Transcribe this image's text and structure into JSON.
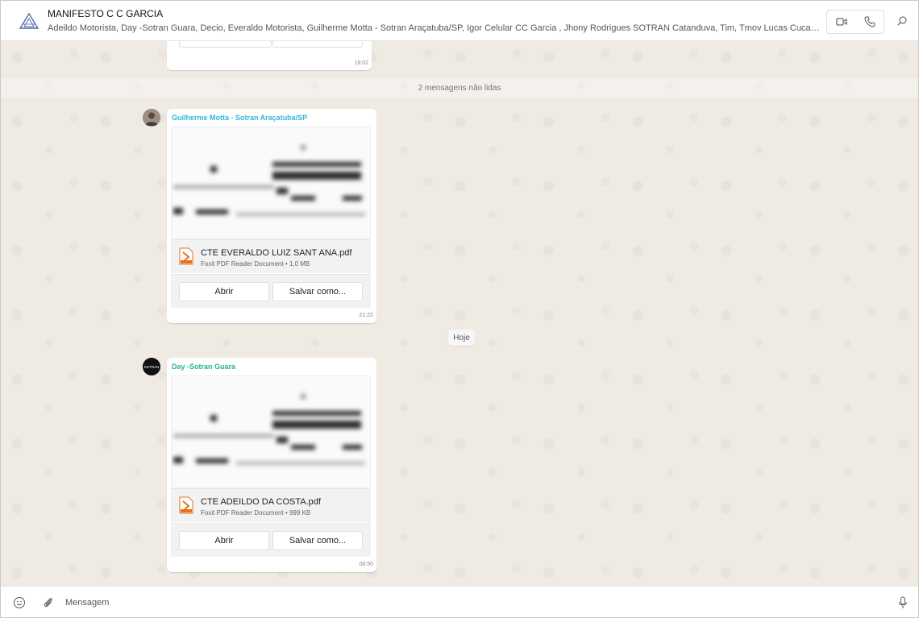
{
  "header": {
    "title": "MANIFESTO C C GARCIA",
    "members": "Adeildo Motorista, Day -Sotran Guara, Decio, Everaldo Motorista, Guilherme Motta - Sotran Araçatuba/SP, Igor Celular CC Garcia , Jhony Rodrigues SOTRAN Catanduva, Tim, Tmov Lucas Cuca, Você",
    "icons": {
      "avatar": "triangle-logo-icon",
      "video": "video-call-icon",
      "voice": "phone-icon",
      "search": "search-icon"
    }
  },
  "chat": {
    "partial_message": {
      "time": "18:02"
    },
    "unread_label": "2 mensagens não lidas",
    "date_chip": "Hoje",
    "messages": [
      {
        "sender": "Guilherme Motta - Sotran Araçatuba/SP",
        "sender_color": "#34b7d9",
        "file_name": "CTE EVERALDO LUIZ SANT ANA.pdf",
        "file_meta": "Foxit PDF Reader Document • 1,0 MB",
        "open_label": "Abrir",
        "save_label": "Salvar como...",
        "time": "21:22"
      },
      {
        "sender": "Day -Sotran Guara",
        "sender_color": "#25b38e",
        "file_name": "CTE ADEILDO DA COSTA.pdf",
        "file_meta": "Foxit PDF Reader Document • 999 KB",
        "open_label": "Abrir",
        "save_label": "Salvar como...",
        "time": "08:50"
      }
    ]
  },
  "composer": {
    "placeholder": "Mensagem",
    "icons": {
      "emoji": "emoji-icon",
      "attach": "paperclip-icon",
      "mic": "microphone-icon"
    }
  },
  "colors": {
    "chat_bg": "#efeae2",
    "accent": "#34b7d9",
    "pdf_icon": "#e8701a"
  }
}
